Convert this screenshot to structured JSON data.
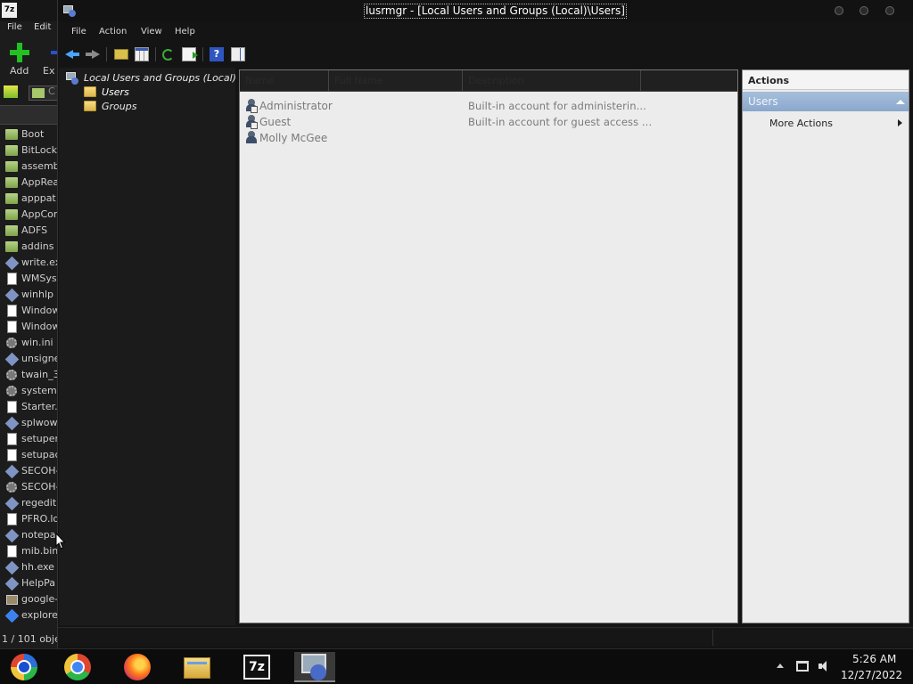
{
  "background_window": {
    "menu": [
      "File",
      "Edit"
    ],
    "toolbar": {
      "add_label": "Add",
      "extract_label": "Ex"
    },
    "path_text": "C",
    "files": [
      {
        "name": "Boot",
        "icon": "folder"
      },
      {
        "name": "BitLocke",
        "icon": "folder"
      },
      {
        "name": "assemb",
        "icon": "folder"
      },
      {
        "name": "AppRea",
        "icon": "folder"
      },
      {
        "name": "apppat",
        "icon": "folder"
      },
      {
        "name": "AppCon",
        "icon": "folder"
      },
      {
        "name": "ADFS",
        "icon": "folder"
      },
      {
        "name": "addins",
        "icon": "folder"
      },
      {
        "name": "write.ex",
        "icon": "exe"
      },
      {
        "name": "WMSys",
        "icon": "file"
      },
      {
        "name": "winhlp",
        "icon": "exe"
      },
      {
        "name": "Window",
        "icon": "file"
      },
      {
        "name": "Window",
        "icon": "file"
      },
      {
        "name": "win.ini",
        "icon": "gear"
      },
      {
        "name": "unsigne",
        "icon": "exe"
      },
      {
        "name": "twain_3",
        "icon": "gear"
      },
      {
        "name": "system.",
        "icon": "gear"
      },
      {
        "name": "Starter.",
        "icon": "file"
      },
      {
        "name": "splwow",
        "icon": "exe"
      },
      {
        "name": "setuper",
        "icon": "file"
      },
      {
        "name": "setupac",
        "icon": "file"
      },
      {
        "name": "SECOH-",
        "icon": "exe"
      },
      {
        "name": "SECOH-",
        "icon": "gear"
      },
      {
        "name": "regedit",
        "icon": "exe"
      },
      {
        "name": "PFRO.lo",
        "icon": "file"
      },
      {
        "name": "notepa",
        "icon": "exe"
      },
      {
        "name": "mib.bin",
        "icon": "file"
      },
      {
        "name": "hh.exe",
        "icon": "exe"
      },
      {
        "name": "HelpPa",
        "icon": "exe"
      },
      {
        "name": "google-",
        "icon": "img"
      },
      {
        "name": "explore",
        "icon": "blue"
      }
    ],
    "status": "1 / 101 objec"
  },
  "window": {
    "title": "lusrmgr - [Local Users and Groups (Local)\\Users]",
    "menu": [
      "File",
      "Action",
      "View",
      "Help"
    ]
  },
  "toolbar_icons": [
    "back-arrow-icon",
    "forward-arrow-icon",
    "up-folder-icon",
    "show-hide-console-tree-icon",
    "refresh-icon",
    "export-list-icon",
    "help-icon",
    "show-hide-action-pane-icon"
  ],
  "tree": {
    "root": "Local Users and Groups (Local)",
    "children": [
      "Users",
      "Groups"
    ],
    "selected": "Users"
  },
  "list": {
    "columns": [
      "Name",
      "Full Name",
      "Description"
    ],
    "rows": [
      {
        "name": "Administrator",
        "full_name": "",
        "description": "Built-in account for administerin..."
      },
      {
        "name": "Guest",
        "full_name": "",
        "description": "Built-in account for guest access ..."
      },
      {
        "name": "Molly McGee",
        "full_name": "",
        "description": ""
      }
    ]
  },
  "actions": {
    "title": "Actions",
    "section": "Users",
    "items": [
      "More Actions"
    ]
  },
  "taskbar": {
    "apps": [
      "start-orb",
      "chrome",
      "firefox",
      "file-explorer",
      "7-zip",
      "lusrmgr"
    ],
    "time": "5:26 AM",
    "date": "12/27/2022"
  },
  "colors": {
    "actions_header": "#8aa7cc",
    "list_background": "#ececec",
    "taskbar": "#0c0c0c"
  }
}
